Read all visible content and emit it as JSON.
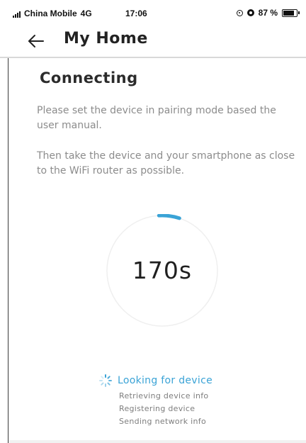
{
  "status_bar": {
    "carrier": "China Mobile",
    "network": "4G",
    "time": "17:06",
    "battery_text": "87 %",
    "battery_level": 0.87,
    "icons": [
      "signal-icon",
      "location-icon",
      "alarm-icon",
      "battery-icon"
    ]
  },
  "header": {
    "back_icon": "back-arrow-icon",
    "title": "My Home"
  },
  "main": {
    "heading": "Connecting",
    "instruction_1": "Please set the device in pairing mode based the user manual.",
    "instruction_2": "Then take the device and your smartphone as close to the WiFi router as possible.",
    "countdown": {
      "value": "170s",
      "progress": 0.06
    },
    "steps": [
      {
        "label": "Looking for device",
        "active": true
      },
      {
        "label": "Retrieving device info",
        "active": false
      },
      {
        "label": "Registering device",
        "active": false
      },
      {
        "label": "Sending network info",
        "active": false
      }
    ]
  },
  "colors": {
    "accent": "#3aa3d6",
    "ring_track": "#eeeeee",
    "text_primary": "#222222",
    "text_secondary": "#8c8c8c"
  }
}
